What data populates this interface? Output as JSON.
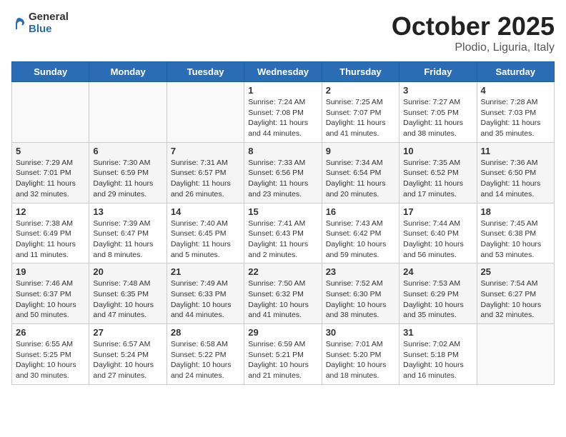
{
  "header": {
    "logo_general": "General",
    "logo_blue": "Blue",
    "month_title": "October 2025",
    "location": "Plodio, Liguria, Italy"
  },
  "weekdays": [
    "Sunday",
    "Monday",
    "Tuesday",
    "Wednesday",
    "Thursday",
    "Friday",
    "Saturday"
  ],
  "weeks": [
    [
      {
        "day": "",
        "info": ""
      },
      {
        "day": "",
        "info": ""
      },
      {
        "day": "",
        "info": ""
      },
      {
        "day": "1",
        "info": "Sunrise: 7:24 AM\nSunset: 7:08 PM\nDaylight: 11 hours and 44 minutes."
      },
      {
        "day": "2",
        "info": "Sunrise: 7:25 AM\nSunset: 7:07 PM\nDaylight: 11 hours and 41 minutes."
      },
      {
        "day": "3",
        "info": "Sunrise: 7:27 AM\nSunset: 7:05 PM\nDaylight: 11 hours and 38 minutes."
      },
      {
        "day": "4",
        "info": "Sunrise: 7:28 AM\nSunset: 7:03 PM\nDaylight: 11 hours and 35 minutes."
      }
    ],
    [
      {
        "day": "5",
        "info": "Sunrise: 7:29 AM\nSunset: 7:01 PM\nDaylight: 11 hours and 32 minutes."
      },
      {
        "day": "6",
        "info": "Sunrise: 7:30 AM\nSunset: 6:59 PM\nDaylight: 11 hours and 29 minutes."
      },
      {
        "day": "7",
        "info": "Sunrise: 7:31 AM\nSunset: 6:57 PM\nDaylight: 11 hours and 26 minutes."
      },
      {
        "day": "8",
        "info": "Sunrise: 7:33 AM\nSunset: 6:56 PM\nDaylight: 11 hours and 23 minutes."
      },
      {
        "day": "9",
        "info": "Sunrise: 7:34 AM\nSunset: 6:54 PM\nDaylight: 11 hours and 20 minutes."
      },
      {
        "day": "10",
        "info": "Sunrise: 7:35 AM\nSunset: 6:52 PM\nDaylight: 11 hours and 17 minutes."
      },
      {
        "day": "11",
        "info": "Sunrise: 7:36 AM\nSunset: 6:50 PM\nDaylight: 11 hours and 14 minutes."
      }
    ],
    [
      {
        "day": "12",
        "info": "Sunrise: 7:38 AM\nSunset: 6:49 PM\nDaylight: 11 hours and 11 minutes."
      },
      {
        "day": "13",
        "info": "Sunrise: 7:39 AM\nSunset: 6:47 PM\nDaylight: 11 hours and 8 minutes."
      },
      {
        "day": "14",
        "info": "Sunrise: 7:40 AM\nSunset: 6:45 PM\nDaylight: 11 hours and 5 minutes."
      },
      {
        "day": "15",
        "info": "Sunrise: 7:41 AM\nSunset: 6:43 PM\nDaylight: 11 hours and 2 minutes."
      },
      {
        "day": "16",
        "info": "Sunrise: 7:43 AM\nSunset: 6:42 PM\nDaylight: 10 hours and 59 minutes."
      },
      {
        "day": "17",
        "info": "Sunrise: 7:44 AM\nSunset: 6:40 PM\nDaylight: 10 hours and 56 minutes."
      },
      {
        "day": "18",
        "info": "Sunrise: 7:45 AM\nSunset: 6:38 PM\nDaylight: 10 hours and 53 minutes."
      }
    ],
    [
      {
        "day": "19",
        "info": "Sunrise: 7:46 AM\nSunset: 6:37 PM\nDaylight: 10 hours and 50 minutes."
      },
      {
        "day": "20",
        "info": "Sunrise: 7:48 AM\nSunset: 6:35 PM\nDaylight: 10 hours and 47 minutes."
      },
      {
        "day": "21",
        "info": "Sunrise: 7:49 AM\nSunset: 6:33 PM\nDaylight: 10 hours and 44 minutes."
      },
      {
        "day": "22",
        "info": "Sunrise: 7:50 AM\nSunset: 6:32 PM\nDaylight: 10 hours and 41 minutes."
      },
      {
        "day": "23",
        "info": "Sunrise: 7:52 AM\nSunset: 6:30 PM\nDaylight: 10 hours and 38 minutes."
      },
      {
        "day": "24",
        "info": "Sunrise: 7:53 AM\nSunset: 6:29 PM\nDaylight: 10 hours and 35 minutes."
      },
      {
        "day": "25",
        "info": "Sunrise: 7:54 AM\nSunset: 6:27 PM\nDaylight: 10 hours and 32 minutes."
      }
    ],
    [
      {
        "day": "26",
        "info": "Sunrise: 6:55 AM\nSunset: 5:25 PM\nDaylight: 10 hours and 30 minutes."
      },
      {
        "day": "27",
        "info": "Sunrise: 6:57 AM\nSunset: 5:24 PM\nDaylight: 10 hours and 27 minutes."
      },
      {
        "day": "28",
        "info": "Sunrise: 6:58 AM\nSunset: 5:22 PM\nDaylight: 10 hours and 24 minutes."
      },
      {
        "day": "29",
        "info": "Sunrise: 6:59 AM\nSunset: 5:21 PM\nDaylight: 10 hours and 21 minutes."
      },
      {
        "day": "30",
        "info": "Sunrise: 7:01 AM\nSunset: 5:20 PM\nDaylight: 10 hours and 18 minutes."
      },
      {
        "day": "31",
        "info": "Sunrise: 7:02 AM\nSunset: 5:18 PM\nDaylight: 10 hours and 16 minutes."
      },
      {
        "day": "",
        "info": ""
      }
    ]
  ]
}
